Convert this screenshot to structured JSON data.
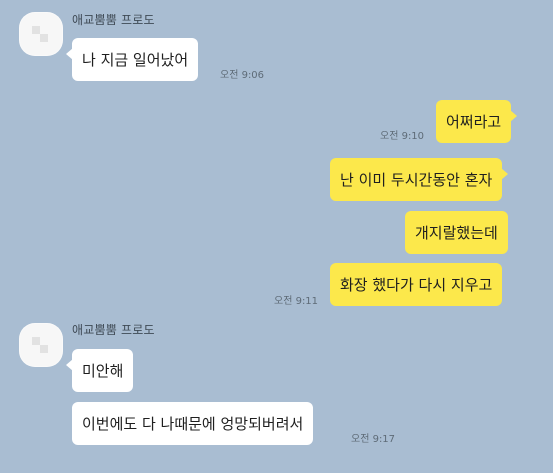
{
  "colors": {
    "background": "#a9bdd2",
    "incoming_bubble": "#ffffff",
    "outgoing_bubble": "#fce84b"
  },
  "conversation": {
    "group1": {
      "sender": "애교뿜뿜 프로도",
      "messages": [
        {
          "text": "나 지금 일어났어",
          "time": "오전 9:06"
        }
      ]
    },
    "group2": {
      "messages": [
        {
          "text": "어쩌라고",
          "time": "오전 9:10"
        }
      ]
    },
    "group3": {
      "messages": [
        {
          "text": "난 이미 두시간동안 혼자"
        },
        {
          "text": "개지랄했는데"
        },
        {
          "text": "화장 했다가 다시 지우고",
          "time": "오전 9:11"
        }
      ]
    },
    "group4": {
      "sender": "애교뿜뿜 프로도",
      "messages": [
        {
          "text": "미안해"
        },
        {
          "text": "이번에도 다 나때문에 엉망되버려서",
          "time": "오전 9:17"
        }
      ]
    }
  }
}
